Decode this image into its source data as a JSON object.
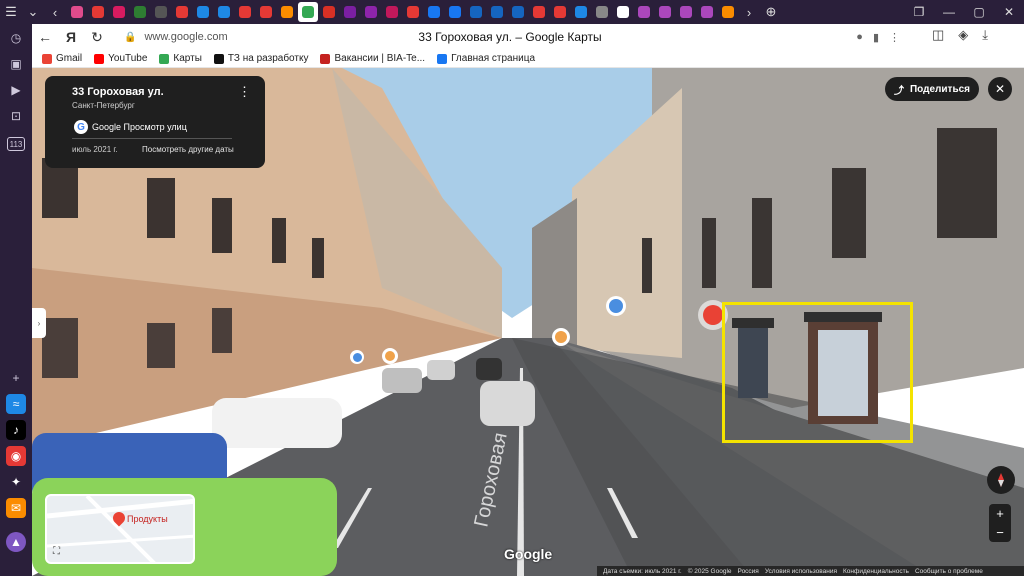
{
  "browser": {
    "url": "www.google.com",
    "page_title": "33 Гороховая ул. – Google Карты",
    "sidebar_count": "113"
  },
  "bookmarks": [
    {
      "label": "Gmail",
      "color": "#ea4335"
    },
    {
      "label": "YouTube",
      "color": "#ff0000"
    },
    {
      "label": "Карты",
      "color": "#34a853"
    },
    {
      "label": "ТЗ на разработку",
      "color": "#111111"
    },
    {
      "label": "Вакансии | BIA-Te...",
      "color": "#c5221f"
    },
    {
      "label": "Главная страница",
      "color": "#1877f2"
    }
  ],
  "info_card": {
    "title": "33 Гороховая ул.",
    "subtitle": "Санкт-Петербург",
    "source": "Google Просмотр улиц",
    "date": "июль 2021 г.",
    "other_dates_link": "Посмотреть другие даты"
  },
  "share_label": "Поделиться",
  "minimap": {
    "label": "Продукты"
  },
  "street_label": "Гороховая",
  "google_logo": "Google",
  "footer": {
    "capture_date": "Дата съемки: июль 2021 г.",
    "copyright": "© 2025 Google",
    "region": "Россия",
    "terms": "Условия использования",
    "privacy": "Конфиденциальность",
    "report": "Сообщить о проблеме"
  },
  "colors": {
    "highlight": "#f4e300",
    "sky": "#a9cde8"
  }
}
